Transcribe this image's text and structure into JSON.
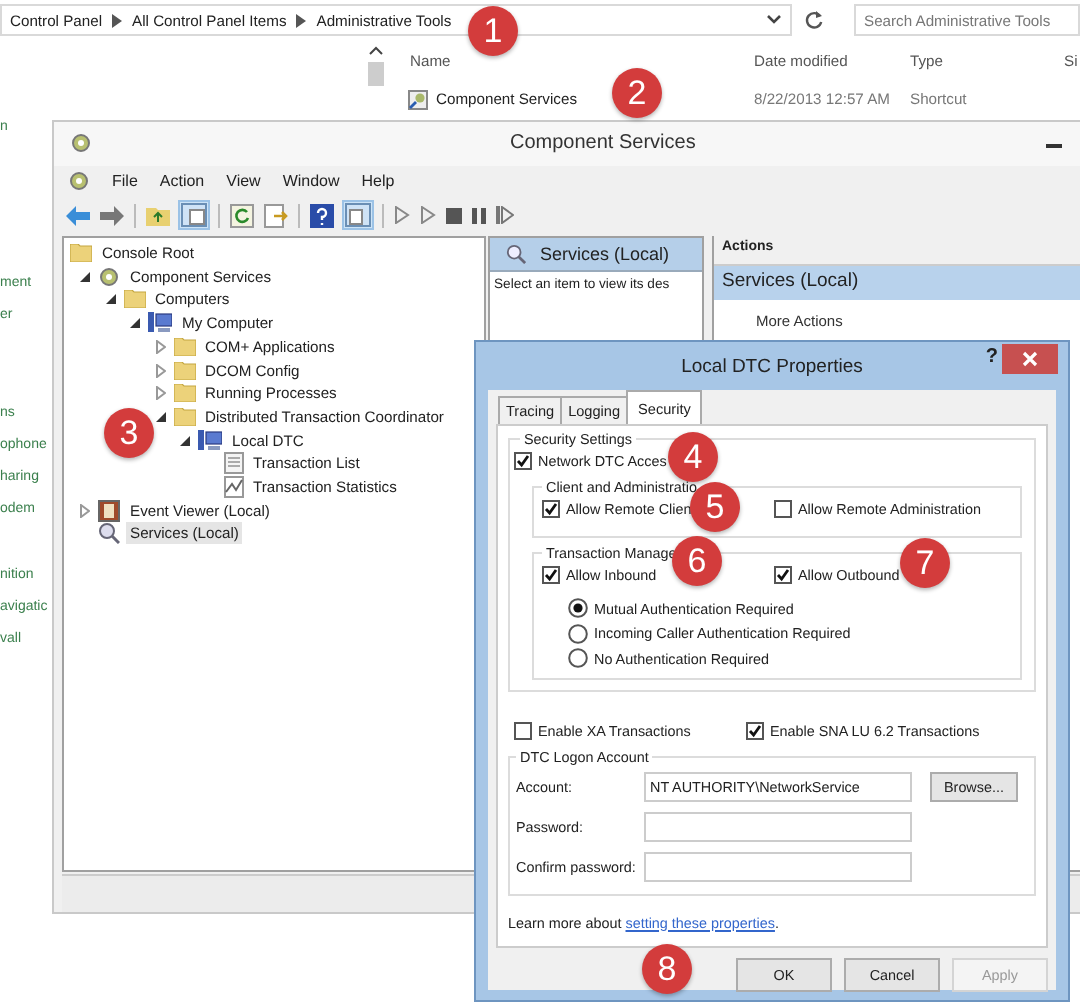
{
  "explorer": {
    "breadcrumb": [
      "Control Panel",
      "All Control Panel Items",
      "Administrative Tools"
    ],
    "search": {
      "placeholder": "Search Administrative Tools"
    },
    "nav_groups": [
      [
        "n"
      ],
      [
        "ment",
        "er"
      ],
      [
        "ns",
        "ophone",
        "haring",
        "odem"
      ],
      [
        "nition",
        "avigatic",
        "vall"
      ]
    ],
    "columns": [
      "Name",
      "Date modified",
      "Type",
      "Si"
    ],
    "rows": [
      {
        "name": "Component Services",
        "date": "8/22/2013 12:57 AM",
        "type": "Shortcut"
      }
    ]
  },
  "mmc": {
    "title": "Component Services",
    "menu": [
      "File",
      "Action",
      "View",
      "Window",
      "Help"
    ],
    "tree": [
      {
        "label": "Console Root",
        "kind": "folder",
        "selected": false,
        "children": [
          {
            "label": "Component Services",
            "kind": "gear",
            "expanded": true,
            "selected": false,
            "children": [
              {
                "label": "Computers",
                "kind": "folder",
                "expanded": true,
                "selected": false,
                "children": [
                  {
                    "label": "My Computer",
                    "kind": "computer",
                    "expanded": true,
                    "selected": false,
                    "children": [
                      {
                        "label": "COM+ Applications",
                        "kind": "folder",
                        "expanded": false,
                        "selected": false
                      },
                      {
                        "label": "DCOM Config",
                        "kind": "folder",
                        "expanded": false,
                        "selected": false
                      },
                      {
                        "label": "Running Processes",
                        "kind": "folder",
                        "expanded": false,
                        "selected": false
                      },
                      {
                        "label": "Distributed Transaction Coordinator",
                        "kind": "folder",
                        "expanded": true,
                        "selected": false,
                        "children": [
                          {
                            "label": "Local DTC",
                            "kind": "computer",
                            "expanded": true,
                            "selected": false,
                            "children": [
                              {
                                "label": "Transaction List",
                                "kind": "doc",
                                "selected": false
                              },
                              {
                                "label": "Transaction Statistics",
                                "kind": "chart",
                                "selected": false
                              }
                            ]
                          }
                        ]
                      }
                    ]
                  }
                ]
              }
            ]
          },
          {
            "label": "Event Viewer (Local)",
            "kind": "event",
            "expanded": false,
            "selected": false
          },
          {
            "label": "Services (Local)",
            "kind": "services",
            "selected": true
          }
        ]
      }
    ],
    "center": {
      "header": "Services (Local)",
      "text": "Select an item to view its des"
    },
    "actions": {
      "header": "Actions",
      "items": [
        {
          "label": "Services (Local)",
          "selected": true
        },
        {
          "label": "More Actions",
          "selected": false
        }
      ]
    }
  },
  "dialog": {
    "title": "Local DTC Properties",
    "help": "?",
    "tabs": [
      {
        "label": "Tracing",
        "selected": false
      },
      {
        "label": "Logging",
        "selected": false
      },
      {
        "label": "Security",
        "selected": true
      }
    ],
    "security_group": "Security Settings",
    "network_access": {
      "label": "Network DTC Acces",
      "checked": true
    },
    "client_group": "Client and Administratio",
    "client_options": [
      {
        "label": "Allow Remote Clien",
        "checked": true
      },
      {
        "label": "Allow Remote Administration",
        "checked": false
      }
    ],
    "tm_group": "Transaction Manage",
    "tm_options": [
      {
        "label": "Allow Inbound",
        "checked": true
      },
      {
        "label": "Allow Outbound",
        "checked": true
      }
    ],
    "auth": [
      {
        "label": "Mutual Authentication Required",
        "selected": true
      },
      {
        "label": "Incoming Caller Authentication Required",
        "selected": false
      },
      {
        "label": "No Authentication Required",
        "selected": false
      }
    ],
    "transactions": [
      {
        "label": "Enable XA Transactions",
        "checked": false
      },
      {
        "label": "Enable SNA LU 6.2 Transactions",
        "checked": true
      }
    ],
    "logon_group": "DTC Logon Account",
    "fields": [
      {
        "label": "Account:",
        "value": "NT AUTHORITY\\NetworkService"
      },
      {
        "label": "Password:"
      },
      {
        "label": "Confirm password:"
      }
    ],
    "browse": "Browse...",
    "learn_more": {
      "text": "Learn more about ",
      "link": "setting these properties",
      "after": "."
    },
    "buttons": [
      {
        "label": "OK",
        "disabled": false
      },
      {
        "label": "Cancel",
        "disabled": false
      },
      {
        "label": "Apply",
        "disabled": true
      }
    ]
  },
  "callouts": [
    "1",
    "2",
    "3",
    "4",
    "5",
    "6",
    "7",
    "8"
  ]
}
